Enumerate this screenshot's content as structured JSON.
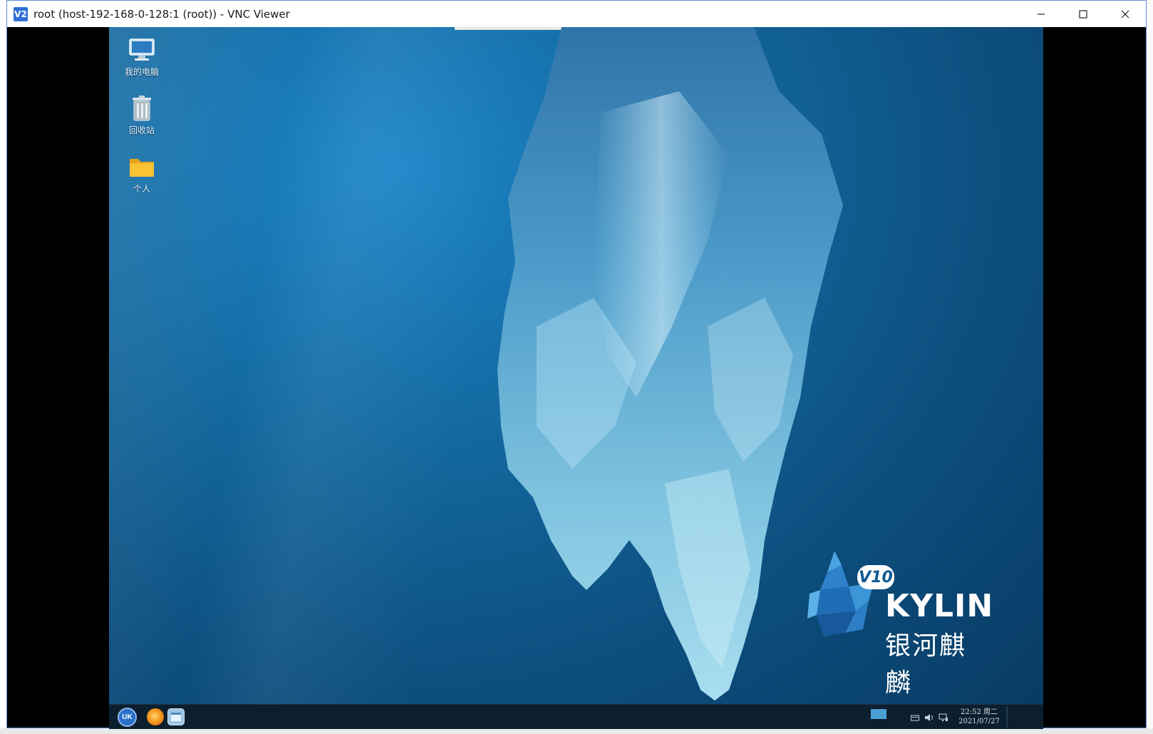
{
  "window": {
    "title": "root (host-192-168-0-128:1 (root)) - VNC Viewer",
    "app_icon_text": "V2",
    "controls": [
      "minimize",
      "maximize",
      "close"
    ]
  },
  "desktop": {
    "icons": [
      {
        "label": "我的电脑",
        "icon": "computer-icon"
      },
      {
        "label": "回收站",
        "icon": "trash-icon"
      },
      {
        "label": "个人",
        "icon": "folder-icon"
      }
    ],
    "logo": {
      "badge": "V10",
      "word": "KYLIN",
      "chinese": "银河麒麟"
    }
  },
  "taskbar": {
    "start_label": "UK",
    "apps": [
      {
        "name": "browser",
        "icon": "browser-icon"
      },
      {
        "name": "file-manager",
        "icon": "file-manager-icon"
      }
    ],
    "tray": [
      "keyboard-icon",
      "volume-icon",
      "network-icon"
    ],
    "clock": {
      "time": "22:52 周二",
      "date": "2021/07/27"
    }
  },
  "colors": {
    "accent": "#2f6fd6",
    "taskbar": "#0c1f2e",
    "desktop": "#13689f"
  }
}
